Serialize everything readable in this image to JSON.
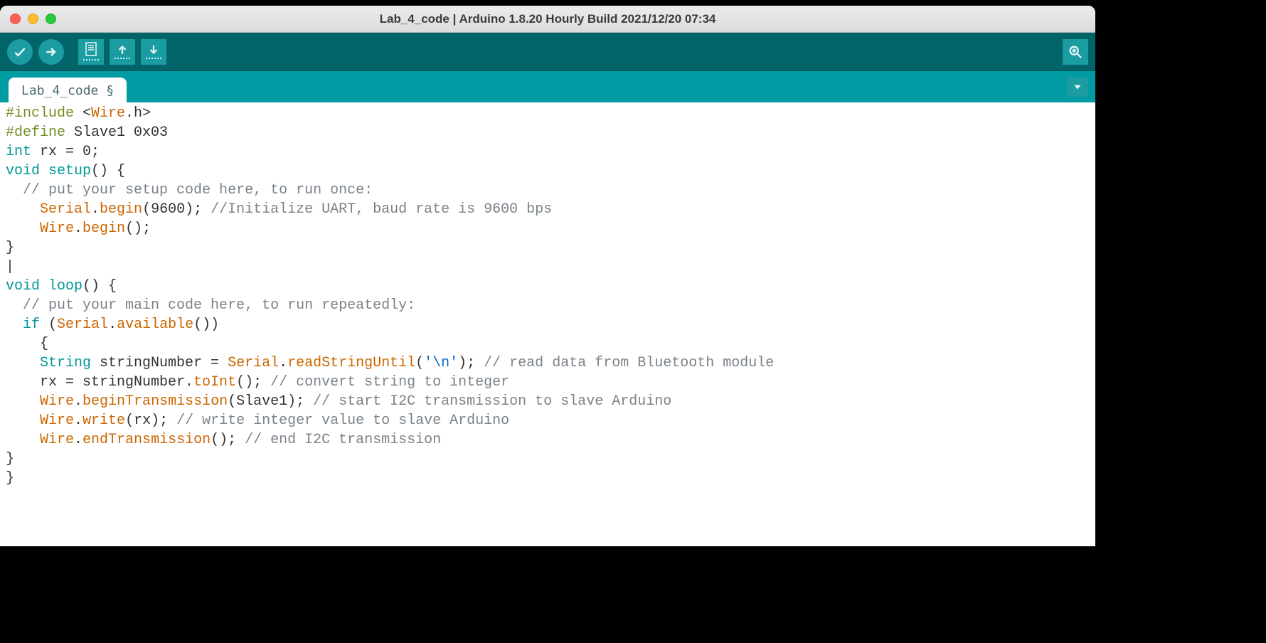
{
  "window": {
    "title": "Lab_4_code | Arduino 1.8.20 Hourly Build 2021/12/20 07:34"
  },
  "toolbar": {
    "verify": "Verify",
    "upload": "Upload",
    "new": "New",
    "open": "Open",
    "save": "Save",
    "serial_monitor": "Serial Monitor"
  },
  "tab": {
    "name": "Lab_4_code",
    "modified_marker": "§"
  },
  "code": {
    "l1_a": "#include",
    "l1_b": " <",
    "l1_c": "Wire",
    "l1_d": ".h>",
    "l2_a": "#define",
    "l2_b": " Slave1 0x03",
    "l3_a": "int",
    "l3_b": " rx = ",
    "l3_c": "0",
    "l3_d": ";",
    "l4_a": "void",
    "l4_b": " ",
    "l4_c": "setup",
    "l4_d": "() {",
    "l5_a": "  ",
    "l5_b": "// put your setup code here, to run once:",
    "l6_a": "    ",
    "l6_b": "Serial",
    "l6_c": ".",
    "l6_d": "begin",
    "l6_e": "(",
    "l6_f": "9600",
    "l6_g": "); ",
    "l6_h": "//Initialize UART, baud rate is 9600 bps",
    "l7_a": "    ",
    "l7_b": "Wire",
    "l7_c": ".",
    "l7_d": "begin",
    "l7_e": "();",
    "l8": "}",
    "l9": "|",
    "l10_a": "void",
    "l10_b": " ",
    "l10_c": "loop",
    "l10_d": "() {",
    "l11_a": "  ",
    "l11_b": "// put your main code here, to run repeatedly:",
    "l12_a": "  ",
    "l12_b": "if",
    "l12_c": " (",
    "l12_d": "Serial",
    "l12_e": ".",
    "l12_f": "available",
    "l12_g": "())",
    "l13": "    {",
    "l14_a": "    ",
    "l14_b": "String",
    "l14_c": " stringNumber = ",
    "l14_d": "Serial",
    "l14_e": ".",
    "l14_f": "readStringUntil",
    "l14_g": "(",
    "l14_h": "'\\n'",
    "l14_i": "); ",
    "l14_j": "// read data from Bluetooth module",
    "l15_a": "    rx = stringNumber.",
    "l15_b": "toInt",
    "l15_c": "(); ",
    "l15_d": "// convert string to integer",
    "l16_a": "    ",
    "l16_b": "Wire",
    "l16_c": ".",
    "l16_d": "beginTransmission",
    "l16_e": "(Slave1); ",
    "l16_f": "// start I2C transmission to slave Arduino",
    "l17_a": "    ",
    "l17_b": "Wire",
    "l17_c": ".",
    "l17_d": "write",
    "l17_e": "(rx); ",
    "l17_f": "// write integer value to slave Arduino",
    "l18_a": "    ",
    "l18_b": "Wire",
    "l18_c": ".",
    "l18_d": "endTransmission",
    "l18_e": "(); ",
    "l18_f": "// end I2C transmission",
    "l19": "}",
    "l20": "}"
  }
}
